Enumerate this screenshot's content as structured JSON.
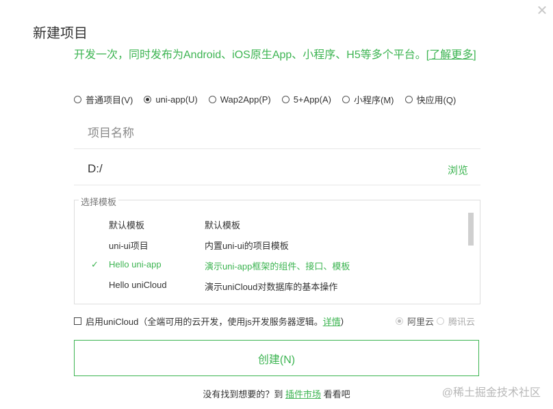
{
  "dialog": {
    "title": "新建项目",
    "subtitle": "开发一次，同时发布为Android、iOS原生App、小程序、H5等多个平台。",
    "learn_more": "[了解更多]"
  },
  "project_types": [
    {
      "label": "普通项目(V)",
      "selected": false
    },
    {
      "label": "uni-app(U)",
      "selected": true
    },
    {
      "label": "Wap2App(P)",
      "selected": false
    },
    {
      "label": "5+App(A)",
      "selected": false
    },
    {
      "label": "小程序(M)",
      "selected": false
    },
    {
      "label": "快应用(Q)",
      "selected": false
    }
  ],
  "name_field": {
    "placeholder": "项目名称",
    "value": ""
  },
  "path_field": {
    "value": "D:/",
    "browse_label": "浏览"
  },
  "templates": {
    "legend": "选择模板",
    "items": [
      {
        "name": "默认模板",
        "desc": "默认模板",
        "selected": false
      },
      {
        "name": "uni-ui项目",
        "desc": "内置uni-ui的项目模板",
        "selected": false
      },
      {
        "name": "Hello uni-app",
        "desc": "演示uni-app框架的组件、接口、模板",
        "selected": true
      },
      {
        "name": "Hello uniCloud",
        "desc": "演示uniCloud对数据库的基本操作",
        "selected": false
      }
    ],
    "check_mark": "✓"
  },
  "unicloud": {
    "label": "启用uniCloud",
    "note": "（全端可用的云开发，使用js开发服务器逻辑。",
    "detail": "详情",
    "note_end": ")",
    "providers": [
      {
        "label": "阿里云",
        "selected": true
      },
      {
        "label": "腾讯云",
        "selected": false
      }
    ]
  },
  "create_button": "创建(N)",
  "footer": {
    "prefix": "没有找到想要的？到 ",
    "market": "插件市场",
    "suffix": " 看看吧"
  },
  "watermark": "@稀土掘金技术社区",
  "colors": {
    "accent": "#3cb451"
  }
}
